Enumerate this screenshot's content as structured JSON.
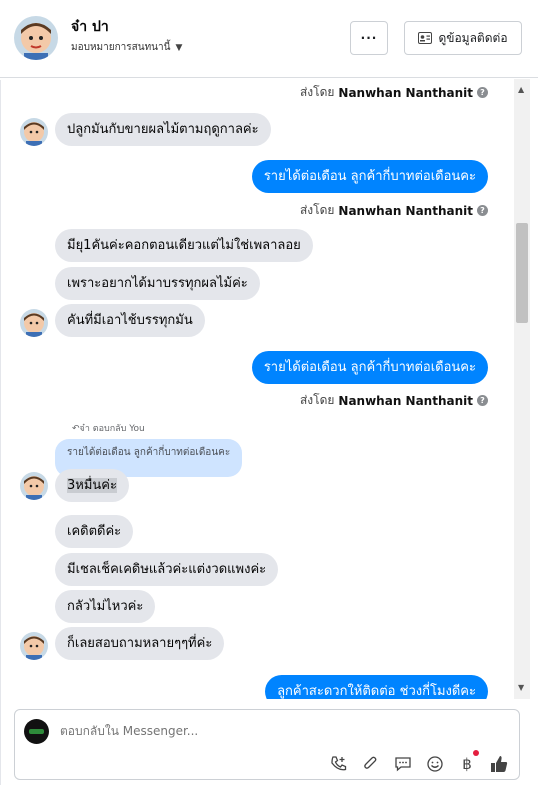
{
  "header": {
    "name": "จ๋า ปา",
    "assign_label": "มอบหมายการสนทนานี้",
    "more_label": "···",
    "contact_label": "ดูข้อมูลติดต่อ"
  },
  "messages": {
    "sent_by_prefix": "ส่งโดย",
    "sender_name": "Nanwhan Nanthanit",
    "m1": "ปลูกมันกับขายผลไม้ตามฤดูกาลค่ะ",
    "m2": "รายได้ต่อเดือน ลูกค้ากี่บาทต่อเดือนคะ",
    "m3": "มียุ1คันค่ะคอกตอนเดียวแต่ไม่ใช่เพลาลอย",
    "m4": "เพราะอยากได้มาบรรทุกผลไม้ค่ะ",
    "m5": "คันที่มีเอาไช้บรรทุกมัน",
    "m6": "รายได้ต่อเดือน ลูกค้ากี่บาทต่อเดือนคะ",
    "reply_note": "จ๋า ตอบกลับ You",
    "quoted": "รายได้ต่อเดือน ลูกค้ากี่บาทต่อเดือนคะ",
    "m7": "3หมื่นค่ะ",
    "m8": "เคดิตดีค่ะ",
    "m9": "มีเชลเช็คเคดิษแล้วค่ะแต่งวดแพงค่ะ",
    "m10": "กลัวไม่ไหวค่ะ",
    "m11": "ก็เลยสอบถามหลายๆๆที่ค่ะ",
    "m12": "ลูกค้าสะดวกให้ติดต่อ ช่วงกี่โมงดีคะ"
  },
  "composer": {
    "placeholder": "ตอบกลับใน Messenger..."
  },
  "icons": {
    "call": "phone-plus-icon",
    "attach": "paperclip-icon",
    "saved": "chat-bubble-icon",
    "emoji": "smiley-icon",
    "payment": "baht-icon",
    "like": "thumbs-up-icon",
    "baht_glyph": "฿"
  },
  "colors": {
    "outgoing": "#0084ff",
    "incoming": "#e4e6eb",
    "quoted": "#cfe4ff"
  }
}
